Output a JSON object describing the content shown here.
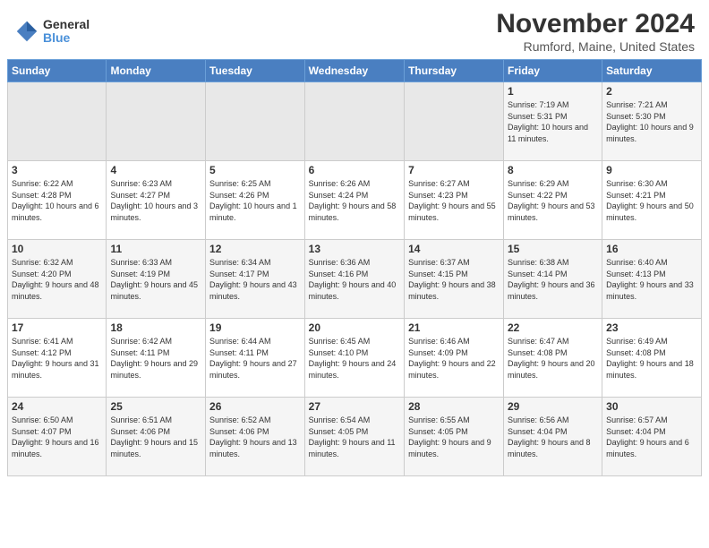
{
  "logo": {
    "general": "General",
    "blue": "Blue"
  },
  "header": {
    "title": "November 2024",
    "subtitle": "Rumford, Maine, United States"
  },
  "weekdays": [
    "Sunday",
    "Monday",
    "Tuesday",
    "Wednesday",
    "Thursday",
    "Friday",
    "Saturday"
  ],
  "weeks": [
    [
      {
        "day": "",
        "info": ""
      },
      {
        "day": "",
        "info": ""
      },
      {
        "day": "",
        "info": ""
      },
      {
        "day": "",
        "info": ""
      },
      {
        "day": "",
        "info": ""
      },
      {
        "day": "1",
        "info": "Sunrise: 7:19 AM\nSunset: 5:31 PM\nDaylight: 10 hours and 11 minutes."
      },
      {
        "day": "2",
        "info": "Sunrise: 7:21 AM\nSunset: 5:30 PM\nDaylight: 10 hours and 9 minutes."
      }
    ],
    [
      {
        "day": "3",
        "info": "Sunrise: 6:22 AM\nSunset: 4:28 PM\nDaylight: 10 hours and 6 minutes."
      },
      {
        "day": "4",
        "info": "Sunrise: 6:23 AM\nSunset: 4:27 PM\nDaylight: 10 hours and 3 minutes."
      },
      {
        "day": "5",
        "info": "Sunrise: 6:25 AM\nSunset: 4:26 PM\nDaylight: 10 hours and 1 minute."
      },
      {
        "day": "6",
        "info": "Sunrise: 6:26 AM\nSunset: 4:24 PM\nDaylight: 9 hours and 58 minutes."
      },
      {
        "day": "7",
        "info": "Sunrise: 6:27 AM\nSunset: 4:23 PM\nDaylight: 9 hours and 55 minutes."
      },
      {
        "day": "8",
        "info": "Sunrise: 6:29 AM\nSunset: 4:22 PM\nDaylight: 9 hours and 53 minutes."
      },
      {
        "day": "9",
        "info": "Sunrise: 6:30 AM\nSunset: 4:21 PM\nDaylight: 9 hours and 50 minutes."
      }
    ],
    [
      {
        "day": "10",
        "info": "Sunrise: 6:32 AM\nSunset: 4:20 PM\nDaylight: 9 hours and 48 minutes."
      },
      {
        "day": "11",
        "info": "Sunrise: 6:33 AM\nSunset: 4:19 PM\nDaylight: 9 hours and 45 minutes."
      },
      {
        "day": "12",
        "info": "Sunrise: 6:34 AM\nSunset: 4:17 PM\nDaylight: 9 hours and 43 minutes."
      },
      {
        "day": "13",
        "info": "Sunrise: 6:36 AM\nSunset: 4:16 PM\nDaylight: 9 hours and 40 minutes."
      },
      {
        "day": "14",
        "info": "Sunrise: 6:37 AM\nSunset: 4:15 PM\nDaylight: 9 hours and 38 minutes."
      },
      {
        "day": "15",
        "info": "Sunrise: 6:38 AM\nSunset: 4:14 PM\nDaylight: 9 hours and 36 minutes."
      },
      {
        "day": "16",
        "info": "Sunrise: 6:40 AM\nSunset: 4:13 PM\nDaylight: 9 hours and 33 minutes."
      }
    ],
    [
      {
        "day": "17",
        "info": "Sunrise: 6:41 AM\nSunset: 4:12 PM\nDaylight: 9 hours and 31 minutes."
      },
      {
        "day": "18",
        "info": "Sunrise: 6:42 AM\nSunset: 4:11 PM\nDaylight: 9 hours and 29 minutes."
      },
      {
        "day": "19",
        "info": "Sunrise: 6:44 AM\nSunset: 4:11 PM\nDaylight: 9 hours and 27 minutes."
      },
      {
        "day": "20",
        "info": "Sunrise: 6:45 AM\nSunset: 4:10 PM\nDaylight: 9 hours and 24 minutes."
      },
      {
        "day": "21",
        "info": "Sunrise: 6:46 AM\nSunset: 4:09 PM\nDaylight: 9 hours and 22 minutes."
      },
      {
        "day": "22",
        "info": "Sunrise: 6:47 AM\nSunset: 4:08 PM\nDaylight: 9 hours and 20 minutes."
      },
      {
        "day": "23",
        "info": "Sunrise: 6:49 AM\nSunset: 4:08 PM\nDaylight: 9 hours and 18 minutes."
      }
    ],
    [
      {
        "day": "24",
        "info": "Sunrise: 6:50 AM\nSunset: 4:07 PM\nDaylight: 9 hours and 16 minutes."
      },
      {
        "day": "25",
        "info": "Sunrise: 6:51 AM\nSunset: 4:06 PM\nDaylight: 9 hours and 15 minutes."
      },
      {
        "day": "26",
        "info": "Sunrise: 6:52 AM\nSunset: 4:06 PM\nDaylight: 9 hours and 13 minutes."
      },
      {
        "day": "27",
        "info": "Sunrise: 6:54 AM\nSunset: 4:05 PM\nDaylight: 9 hours and 11 minutes."
      },
      {
        "day": "28",
        "info": "Sunrise: 6:55 AM\nSunset: 4:05 PM\nDaylight: 9 hours and 9 minutes."
      },
      {
        "day": "29",
        "info": "Sunrise: 6:56 AM\nSunset: 4:04 PM\nDaylight: 9 hours and 8 minutes."
      },
      {
        "day": "30",
        "info": "Sunrise: 6:57 AM\nSunset: 4:04 PM\nDaylight: 9 hours and 6 minutes."
      }
    ]
  ]
}
